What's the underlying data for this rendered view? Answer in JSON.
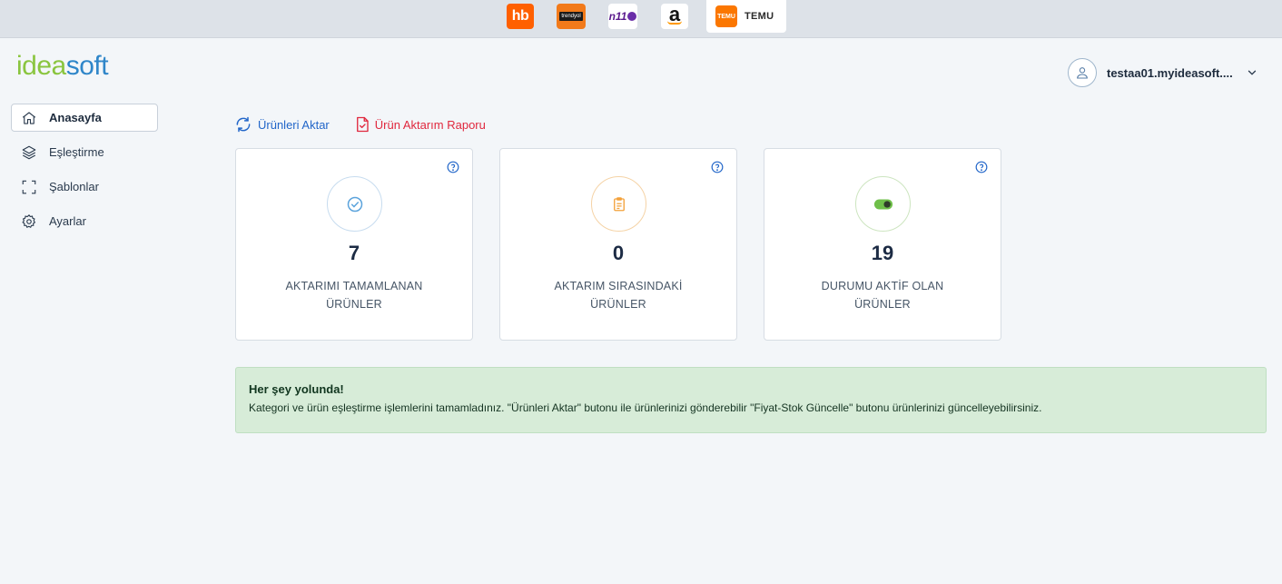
{
  "marketplaces": {
    "hepsiburada": "hb",
    "trendyol": "trendyol",
    "n11": "n11",
    "amazon": "a",
    "temu_mark": "TEMU",
    "temu_label": "TEMU"
  },
  "logo": {
    "part1": "idea",
    "part2": "soft"
  },
  "sidebar": {
    "items": [
      {
        "label": "Anasayfa",
        "icon": "home-icon",
        "active": true
      },
      {
        "label": "Eşleştirme",
        "icon": "layers-icon",
        "active": false
      },
      {
        "label": "Şablonlar",
        "icon": "frame-icon",
        "active": false
      },
      {
        "label": "Ayarlar",
        "icon": "gear-icon",
        "active": false
      }
    ]
  },
  "user": {
    "name": "testaa01.myideasoft...."
  },
  "actions": {
    "transfer_label": "Ürünleri Aktar",
    "report_label": "Ürün Aktarım Raporu"
  },
  "cards": [
    {
      "count": "7",
      "label": "AKTARIMI TAMAMLANAN ÜRÜNLER",
      "icon": "check-circle-icon",
      "color": "#5ba3dc"
    },
    {
      "count": "0",
      "label": "AKTARIM SIRASINDAKİ ÜRÜNLER",
      "icon": "clipboard-icon",
      "color": "#f3a13a"
    },
    {
      "count": "19",
      "label": "DURUMU AKTİF OLAN ÜRÜNLER",
      "icon": "toggle-icon",
      "color": "#6fbf4a"
    }
  ],
  "alert": {
    "title": "Her şey yolunda!",
    "text": "Kategori ve ürün eşleştirme işlemlerini tamamladınız. \"Ürünleri Aktar\" butonu ile ürünlerinizi gönderebilir \"Fiyat-Stok Güncelle\" butonu ürünlerinizi güncelleyebilirsiniz."
  },
  "colors": {
    "accent_blue": "#2266c9",
    "report_red": "#e0283e",
    "alert_bg": "#d7ecd8"
  }
}
